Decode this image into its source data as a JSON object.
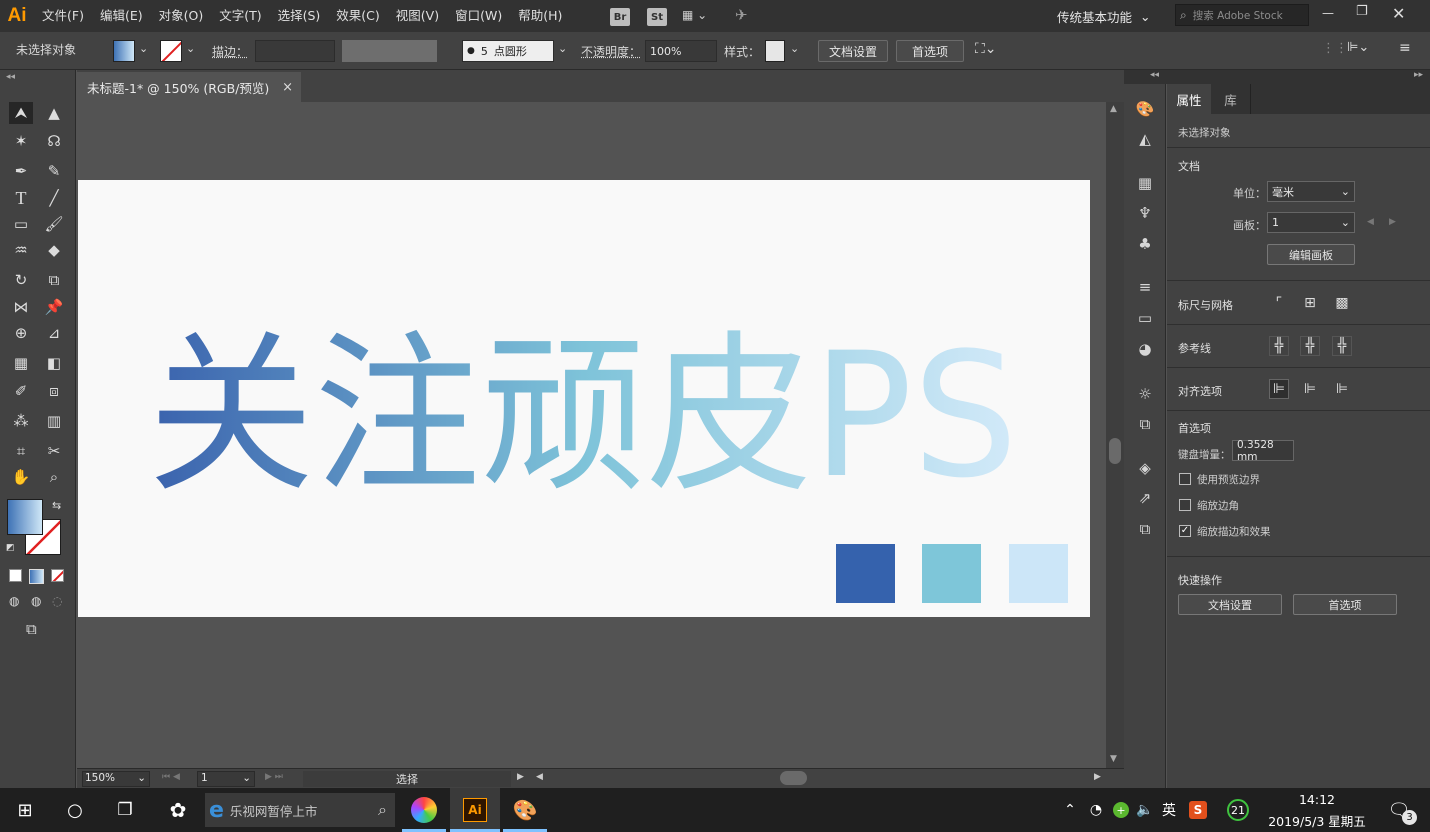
{
  "menubar": {
    "logo": "Ai",
    "items": [
      "文件(F)",
      "编辑(E)",
      "对象(O)",
      "文字(T)",
      "选择(S)",
      "效果(C)",
      "视图(V)",
      "窗口(W)",
      "帮助(H)"
    ],
    "bridge_label": "Br",
    "stock_label": "St",
    "workspace": "传统基本功能",
    "search_placeholder": "搜索 Adobe Stock"
  },
  "controlbar": {
    "selection_label": "未选择对象",
    "stroke_label": "描边：",
    "brush_size": "5",
    "brush_label": "点圆形",
    "opacity_label": "不透明度：",
    "opacity_value": "100%",
    "style_label": "样式：",
    "doc_settings": "文档设置",
    "preferences": "首选项"
  },
  "document": {
    "tab_title": "未标题-1* @ 150% (RGB/预览)",
    "close": "×",
    "artwork_text": "关注顽皮PS",
    "swatch_colors": [
      "#3562ad",
      "#7ec6d9",
      "#cce6f8"
    ]
  },
  "statusbar": {
    "zoom": "150%",
    "artboard_num": "1",
    "status": "选择"
  },
  "props": {
    "tab_properties": "属性",
    "tab_library": "库",
    "no_selection": "未选择对象",
    "document_title": "文档",
    "unit_label": "单位：",
    "unit_value": "毫米",
    "artboard_label": "画板：",
    "artboard_value": "1",
    "edit_artboard": "编辑画板",
    "rulers_grids": "标尺与网格",
    "guides": "参考线",
    "align_options": "对齐选项",
    "preferences_title": "首选项",
    "keyboard_increment_label": "键盘增量：",
    "keyboard_increment_value": "0.3528 mm",
    "use_preview_bounds": "使用预览边界",
    "scale_corners": "缩放边角",
    "scale_strokes_effects": "缩放描边和效果",
    "quick_actions": "快速操作",
    "doc_settings_btn": "文档设置",
    "prefs_btn": "首选项"
  },
  "taskbar": {
    "search_text": "乐视网暂停上市",
    "lang": "英",
    "time": "14:12",
    "date": "2019/5/3 星期五",
    "notif_count": "3",
    "badge_21": "21",
    "ai_label": "Ai"
  }
}
